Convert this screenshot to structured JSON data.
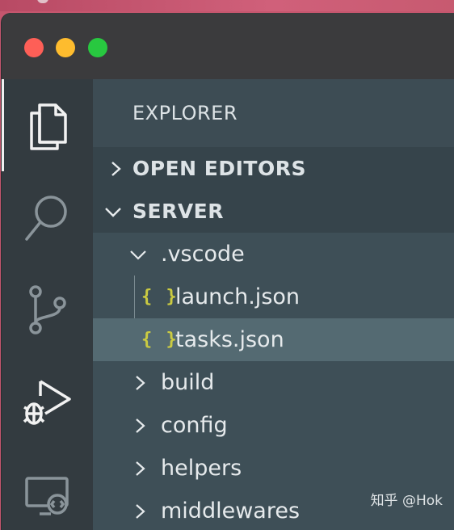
{
  "window": {
    "controls": [
      "close",
      "minimize",
      "maximize"
    ]
  },
  "activity_bar": {
    "items": [
      {
        "name": "explorer",
        "icon": "files-icon",
        "active": true
      },
      {
        "name": "search",
        "icon": "search-icon"
      },
      {
        "name": "source-control",
        "icon": "source-control-icon"
      },
      {
        "name": "run-and-debug",
        "icon": "run-debug-icon"
      },
      {
        "name": "remote-explorer",
        "icon": "remote-explorer-icon"
      }
    ]
  },
  "explorer": {
    "title": "EXPLORER",
    "sections": {
      "open_editors": "OPEN EDITORS",
      "server": "SERVER"
    },
    "tree": {
      "vscode_folder": ".vscode",
      "files": {
        "launch": "launch.json",
        "tasks": "tasks.json"
      },
      "json_icon": "{ }",
      "folders": {
        "build": "build",
        "config": "config",
        "helpers": "helpers",
        "middlewares": "middlewares"
      },
      "selected": "tasks.json"
    }
  },
  "watermark": "知乎 @Hok",
  "colors": {
    "activity_bar": "#333b40",
    "sidebar": "#37474f",
    "selected_row": "#546a72",
    "json_icon": "#cbcb41"
  }
}
